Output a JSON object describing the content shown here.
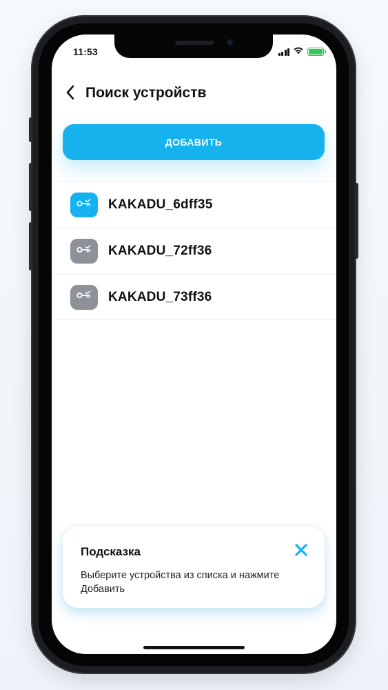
{
  "status_bar": {
    "time": "11:53",
    "icons": [
      "signal-icon",
      "wifi-icon",
      "battery-charging-icon"
    ]
  },
  "header": {
    "back_icon": "chevron-left-icon",
    "title": "Поиск устройств"
  },
  "add_button": {
    "label": "ДОБАВИТЬ",
    "color": "#16b2ee"
  },
  "devices": [
    {
      "name": "KAKADU_6dff35",
      "icon": "key-icon",
      "selected": true,
      "icon_color": "#16b2ee"
    },
    {
      "name": "KAKADU_72ff36",
      "icon": "key-icon",
      "selected": false,
      "icon_color": "#8e9197"
    },
    {
      "name": "KAKADU_73ff36",
      "icon": "key-icon",
      "selected": false,
      "icon_color": "#8e9197"
    }
  ],
  "hint": {
    "title": "Подсказка",
    "text": "Выберите устройства из списка и нажмите Добавить",
    "close_icon": "close-icon",
    "close_color": "#16b2ee"
  }
}
